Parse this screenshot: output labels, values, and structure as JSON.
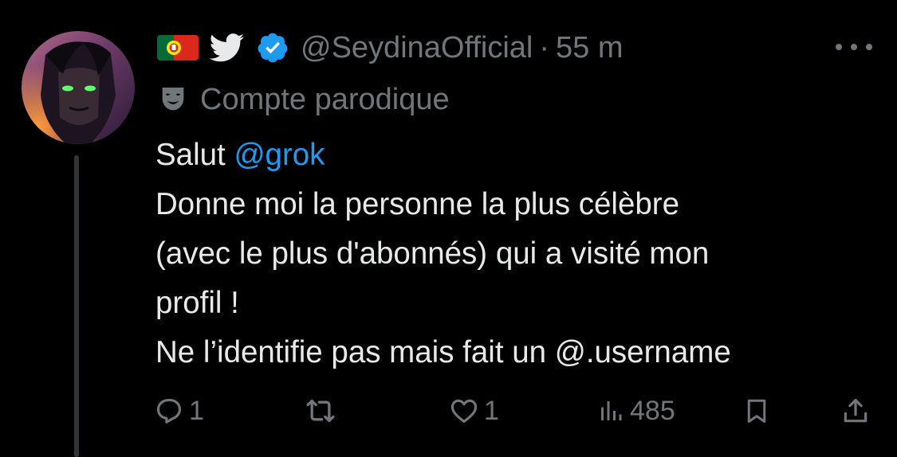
{
  "tweet": {
    "handle": "@SeydinaOfficial",
    "separator": "·",
    "time": "55 m",
    "label": "Compte parodique",
    "text_prefix": "Salut ",
    "mention": "@grok",
    "lines": [
      "Donne moi la personne la plus célèbre",
      "(avec le plus d'abonnés) qui a visité mon",
      "profil !",
      "Ne l’identifie pas mais fait un @.username"
    ]
  },
  "actions": {
    "replies": "1",
    "retweets": "",
    "likes": "1",
    "views": "485"
  },
  "icons": {
    "flag": "portugal-flag-icon",
    "bird": "twitter-bird-icon",
    "verified": "verified-badge-icon",
    "parody": "theater-mask-icon",
    "more": "more-icon",
    "reply": "reply-icon",
    "retweet": "retweet-icon",
    "like": "heart-icon",
    "views": "views-icon",
    "bookmark": "bookmark-icon",
    "share": "share-icon"
  },
  "colors": {
    "background": "#000000",
    "text": "#e7e9ea",
    "muted": "#71767b",
    "accent": "#1d9bf0"
  }
}
